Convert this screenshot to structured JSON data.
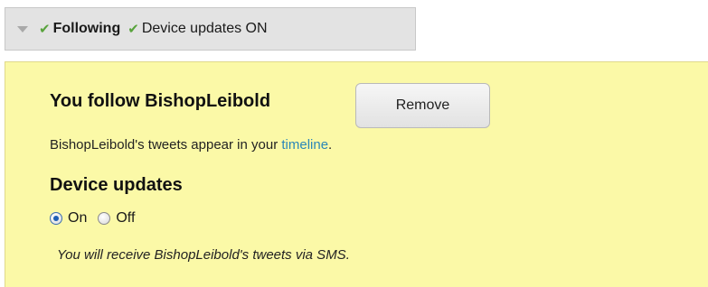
{
  "status_bar": {
    "following_label": "Following",
    "device_updates_label": "Device updates ON"
  },
  "panel": {
    "follow_heading": "You follow BishopLeibold",
    "remove_button_label": "Remove",
    "timeline_text_before": "BishopLeibold's tweets appear in your ",
    "timeline_link_label": "timeline",
    "timeline_text_after": ".",
    "device_heading": "Device updates",
    "radio_on_label": "On",
    "radio_off_label": "Off",
    "selected_option": "On",
    "sms_note": "You will receive BishopLeibold's tweets via SMS."
  },
  "colors": {
    "panel_background": "#fbf9a7",
    "status_bar_background": "#e3e3e3",
    "check_green": "#58a33c",
    "link_blue": "#2b87b8"
  },
  "icons": [
    "dropdown-arrow-icon",
    "check-icon",
    "radio-selected",
    "radio-unselected"
  ]
}
